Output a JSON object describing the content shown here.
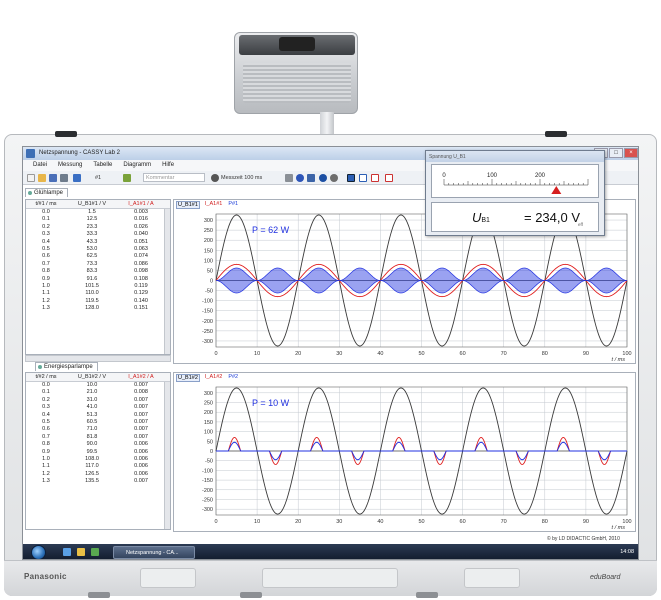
{
  "window": {
    "title": "Netzspannung - CASSY Lab 2"
  },
  "menu": [
    "Datei",
    "Messung",
    "Tabelle",
    "Diagramm",
    "Hilfe"
  ],
  "toolbar": {
    "channel": "#1",
    "comment_placeholder": "Kommentar",
    "measure_time": "Messzeit 100 ms"
  },
  "top_panel": {
    "tab": "Glühlampe",
    "headers": [
      "t/#1 / ms",
      "U_B1#1 / V",
      "I_A1#1 / A"
    ],
    "rows": [
      [
        "0.0",
        "1.5",
        "0.003"
      ],
      [
        "0.1",
        "12.5",
        "0.016"
      ],
      [
        "0.2",
        "23.3",
        "0.026"
      ],
      [
        "0.3",
        "33.3",
        "0.040"
      ],
      [
        "0.4",
        "43.3",
        "0.051"
      ],
      [
        "0.5",
        "53.0",
        "0.063"
      ],
      [
        "0.6",
        "62.5",
        "0.074"
      ],
      [
        "0.7",
        "73.3",
        "0.086"
      ],
      [
        "0.8",
        "83.3",
        "0.098"
      ],
      [
        "0.9",
        "91.6",
        "0.108"
      ],
      [
        "1.0",
        "101.5",
        "0.119"
      ],
      [
        "1.1",
        "110.0",
        "0.129"
      ],
      [
        "1.2",
        "119.5",
        "0.140"
      ],
      [
        "1.3",
        "128.0",
        "0.151"
      ]
    ],
    "graph_tabs": [
      "U_B1#1",
      "I_A1#1",
      "P#1"
    ],
    "power_label": "P = 62 W"
  },
  "bottom_panel": {
    "tab": "Energiesparlampe",
    "headers": [
      "t/#2 / ms",
      "U_B1#2 / V",
      "I_A1#2 / A"
    ],
    "rows": [
      [
        "0.0",
        "10.0",
        "0.007"
      ],
      [
        "0.1",
        "21.0",
        "0.008"
      ],
      [
        "0.2",
        "31.0",
        "0.007"
      ],
      [
        "0.3",
        "41.0",
        "0.007"
      ],
      [
        "0.4",
        "51.3",
        "0.007"
      ],
      [
        "0.5",
        "60.5",
        "0.007"
      ],
      [
        "0.6",
        "71.0",
        "0.007"
      ],
      [
        "0.7",
        "81.8",
        "0.007"
      ],
      [
        "0.8",
        "90.0",
        "0.006"
      ],
      [
        "0.9",
        "99.5",
        "0.006"
      ],
      [
        "1.0",
        "108.0",
        "0.006"
      ],
      [
        "1.1",
        "117.0",
        "0.006"
      ],
      [
        "1.2",
        "126.5",
        "0.006"
      ],
      [
        "1.3",
        "135.5",
        "0.007"
      ]
    ],
    "graph_tabs": [
      "U_B1#2",
      "I_A1#2",
      "P#2"
    ],
    "power_label": "P = 10 W"
  },
  "meter": {
    "title": "Spannung U_B1",
    "scale_ticks": [
      "0",
      "100",
      "200"
    ],
    "label": "U",
    "label_sub": "B1",
    "value": "= 234,0 V",
    "mode": "eff"
  },
  "chart_data": [
    {
      "type": "line",
      "xlabel": "t / ms",
      "ticks_x": [
        "0",
        "10",
        "20",
        "30",
        "40",
        "50",
        "60",
        "70",
        "80",
        "90",
        "100"
      ],
      "ticks_y": [
        "300",
        "250",
        "200",
        "150",
        "100",
        "50",
        "0",
        "-50",
        "-100",
        "-150",
        "-200",
        "-250",
        "-300"
      ],
      "xlim": [
        0,
        100
      ],
      "ylim": [
        -330,
        330
      ],
      "period_ms": 20,
      "series": [
        {
          "name": "U_B1#1",
          "color": "#3a3a3a",
          "amplitude": 325,
          "shape": "sine"
        },
        {
          "name": "I_A1#1",
          "color": "#e02020",
          "amplitude": 80,
          "shape": "sine"
        },
        {
          "name": "P#1",
          "color": "#2030e0",
          "amplitude": 62,
          "shape": "power-fill"
        }
      ]
    },
    {
      "type": "line",
      "xlabel": "t / ms",
      "ticks_x": [
        "0",
        "10",
        "20",
        "30",
        "40",
        "50",
        "60",
        "70",
        "80",
        "90",
        "100"
      ],
      "ticks_y": [
        "300",
        "250",
        "200",
        "150",
        "100",
        "50",
        "0",
        "-50",
        "-100",
        "-150",
        "-200",
        "-250",
        "-300"
      ],
      "xlim": [
        0,
        100
      ],
      "ylim": [
        -330,
        330
      ],
      "period_ms": 20,
      "series": [
        {
          "name": "U_B1#2",
          "color": "#3a3a3a",
          "amplitude": 325,
          "shape": "sine"
        },
        {
          "name": "I_A1#2",
          "color": "#e02020",
          "amplitude": 70,
          "shape": "pulse"
        },
        {
          "name": "P#2",
          "color": "#2030e0",
          "amplitude": 45,
          "shape": "pulse"
        }
      ]
    }
  ],
  "copyright": "© by LD DIDACTIC GmbH, 2010",
  "taskbar": {
    "item": "Netzspannung - CA...",
    "clock": "14:08"
  },
  "board": {
    "brand": "Panasonic",
    "brand2": "eduBoard"
  },
  "colors": {
    "titlebar": "#c3d2e7",
    "grid": "#bfc4cc",
    "voltage": "#3a3a3a",
    "current": "#e02020",
    "power": "#2030e0"
  }
}
